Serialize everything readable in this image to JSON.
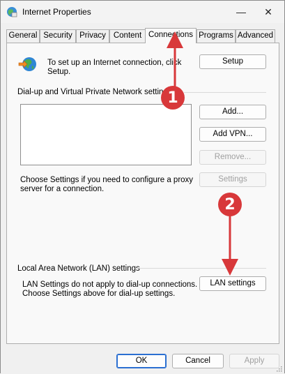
{
  "window": {
    "title": "Internet Properties",
    "minimize": "—",
    "close": "✕"
  },
  "tabs": [
    "General",
    "Security",
    "Privacy",
    "Content",
    "Connections",
    "Programs",
    "Advanced"
  ],
  "active_tab": "Connections",
  "setup": {
    "text_line1": "To set up an Internet connection, click",
    "text_line2": "Setup.",
    "button": "Setup"
  },
  "dialup": {
    "group_label": "Dial-up and Virtual Private Network settings",
    "add": "Add...",
    "add_vpn": "Add VPN...",
    "remove": "Remove...",
    "settings": "Settings",
    "proxy_line1": "Choose Settings if you need to configure a proxy",
    "proxy_line2": "server for a connection."
  },
  "lan": {
    "group_label": "Local Area Network (LAN) settings",
    "line1": "LAN Settings do not apply to dial-up connections.",
    "line2": "Choose Settings above for dial-up settings.",
    "button": "LAN settings"
  },
  "footer": {
    "ok": "OK",
    "cancel": "Cancel",
    "apply": "Apply"
  },
  "annotations": {
    "step1": "1",
    "step2": "2",
    "color": "#d8383a"
  }
}
